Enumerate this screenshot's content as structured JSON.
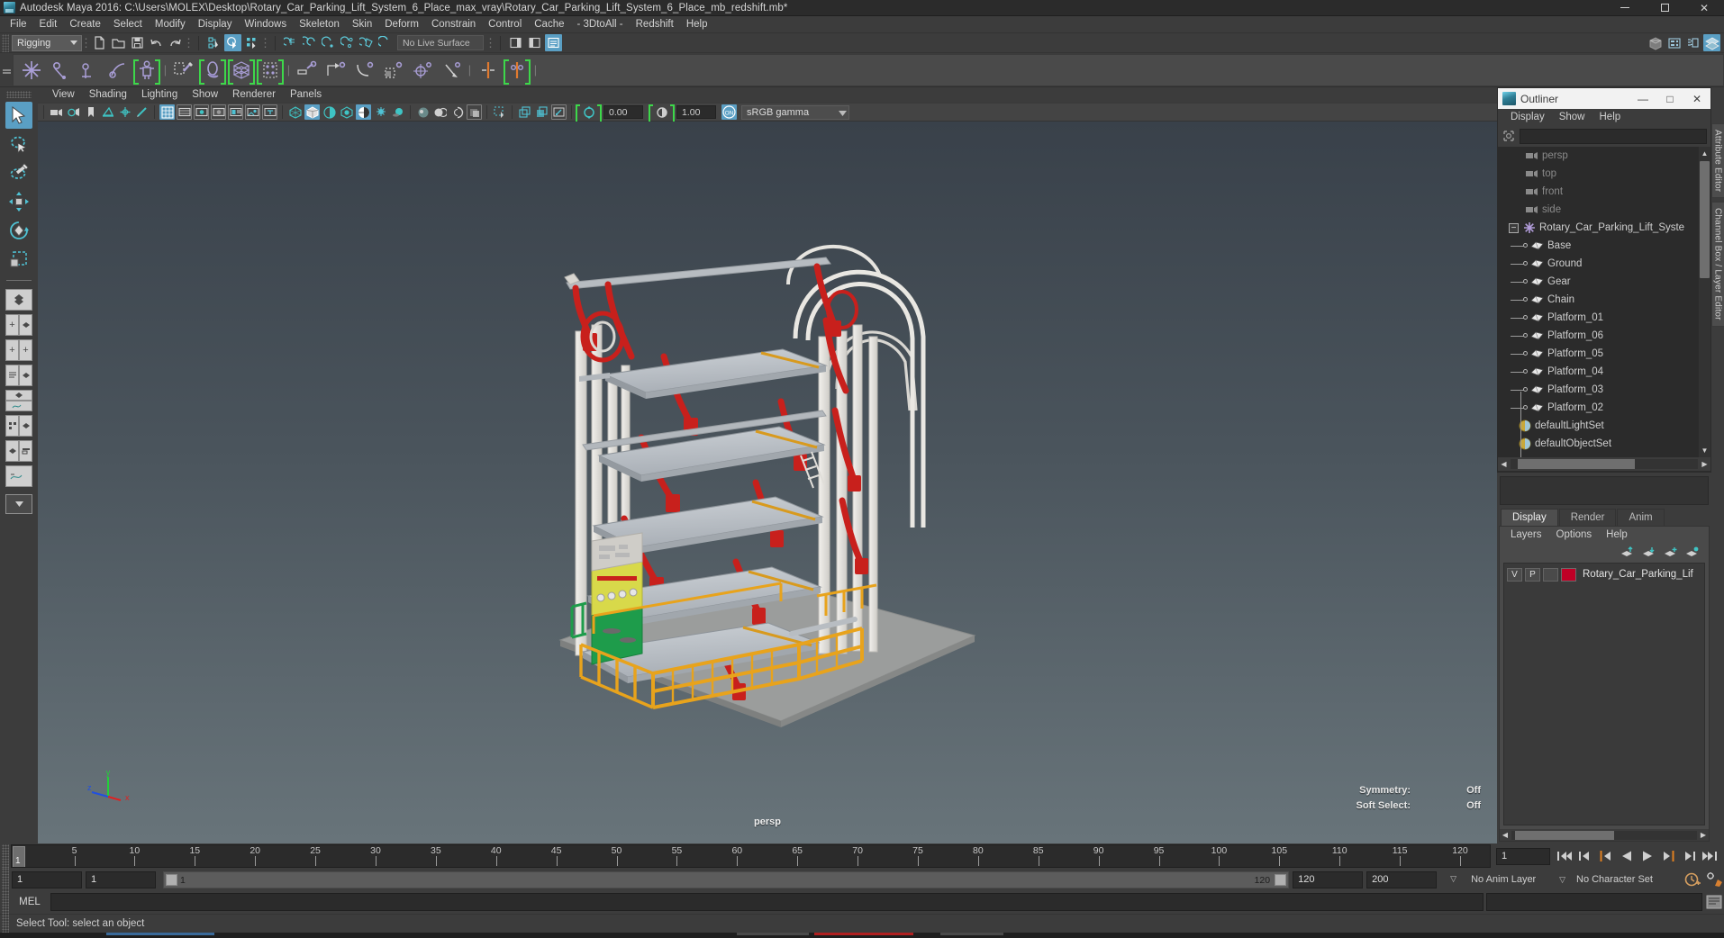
{
  "window": {
    "title": "Autodesk Maya 2016: C:\\Users\\MOLEX\\Desktop\\Rotary_Car_Parking_Lift_System_6_Place_max_vray\\Rotary_Car_Parking_Lift_System_6_Place_mb_redshift.mb*",
    "minimize": "—",
    "maximize": "□",
    "close": "✕"
  },
  "menubar": {
    "items": [
      "File",
      "Edit",
      "Create",
      "Select",
      "Modify",
      "Display",
      "Windows",
      "Skeleton",
      "Skin",
      "Deform",
      "Constrain",
      "Control",
      "Cache",
      "- 3DtoAll -",
      "Redshift",
      "Help"
    ]
  },
  "statusline": {
    "menuset": "Rigging",
    "live_surface": "No Live Surface",
    "dropdown_arrow": "▼"
  },
  "viewport_menu": {
    "items": [
      "View",
      "Shading",
      "Lighting",
      "Show",
      "Renderer",
      "Panels"
    ]
  },
  "viewport_toolbar": {
    "exposure_value": "0.00",
    "gamma_value": "1.00",
    "color_mgmt_toggle": "ON",
    "view_transform": "sRGB gamma",
    "dropdown_arrow": "▼"
  },
  "viewport": {
    "camera_label": "persp",
    "symmetry_label": "Symmetry:",
    "symmetry_value": "Off",
    "soft_select_label": "Soft Select:",
    "soft_select_value": "Off",
    "axis": {
      "x": "x",
      "y": "y",
      "z": "z"
    }
  },
  "outliner": {
    "title": "Outliner",
    "menus": [
      "Display",
      "Show",
      "Help"
    ],
    "search_value": "",
    "search_placeholder": "",
    "window_buttons": {
      "min": "—",
      "max": "□",
      "close": "✕"
    },
    "expander_symbol": "−",
    "cameras": [
      "persp",
      "top",
      "front",
      "side"
    ],
    "root": "Rotary_Car_Parking_Lift_Syste",
    "children": [
      "Base",
      "Ground",
      "Gear",
      "Chain",
      "Platform_01",
      "Platform_06",
      "Platform_05",
      "Platform_04",
      "Platform_03",
      "Platform_02"
    ],
    "sets": [
      "defaultLightSet",
      "defaultObjectSet"
    ]
  },
  "channelbox": {
    "tabs": [
      "Display",
      "Render",
      "Anim"
    ],
    "active_tab": "Display",
    "menus": [
      "Layers",
      "Options",
      "Help"
    ],
    "layer": {
      "visibility": "V",
      "playback": "P",
      "shading": "",
      "color": "#c00026",
      "name": "Rotary_Car_Parking_Lif"
    }
  },
  "right_tabs": [
    "Attribute Editor",
    "Channel Box / Layer Editor"
  ],
  "timeline": {
    "current_frame": "1",
    "frame_field": "1",
    "ticks": [
      5,
      10,
      15,
      20,
      25,
      30,
      35,
      40,
      45,
      50,
      55,
      60,
      65,
      70,
      75,
      80,
      85,
      90,
      95,
      100,
      105,
      110,
      115,
      120
    ],
    "start": 1,
    "end": 120,
    "playback_buttons": [
      "go-to-start",
      "step-back-key",
      "step-back-frame",
      "play-backwards",
      "play-forwards",
      "step-forward-frame",
      "step-forward-key",
      "go-to-end"
    ]
  },
  "range_slider": {
    "anim_start": "1",
    "playback_start": "1",
    "playback_end": "120",
    "anim_end": "200",
    "range_left_label": "1",
    "range_right_label": "120",
    "anim_layer": "No Anim Layer",
    "character_set": "No Character Set",
    "dropdown_arrow": "▽"
  },
  "command_line": {
    "label": "MEL",
    "input_value": "",
    "result_value": ""
  },
  "help_line": {
    "text": "Select Tool: select an object"
  },
  "colors": {
    "accent_blue": "#5a9fc4",
    "green_bracket": "#3dd84a",
    "layer_red": "#c00026",
    "panel_bg": "#3c3c3c",
    "tree_bg": "#2b2b2b",
    "viewport_top": "#39414a",
    "viewport_bottom": "#68747a"
  },
  "model": {
    "name": "Rotary Car Parking Lift System",
    "frame_color": "#e8e6e2",
    "platform_color": "#b9bec4",
    "arm_color": "#c8201c",
    "rail_color": "#e8a31c",
    "ground_color": "#9a9a98",
    "panel_green": "#1e9c4b",
    "panel_yellow": "#d9d94b"
  }
}
